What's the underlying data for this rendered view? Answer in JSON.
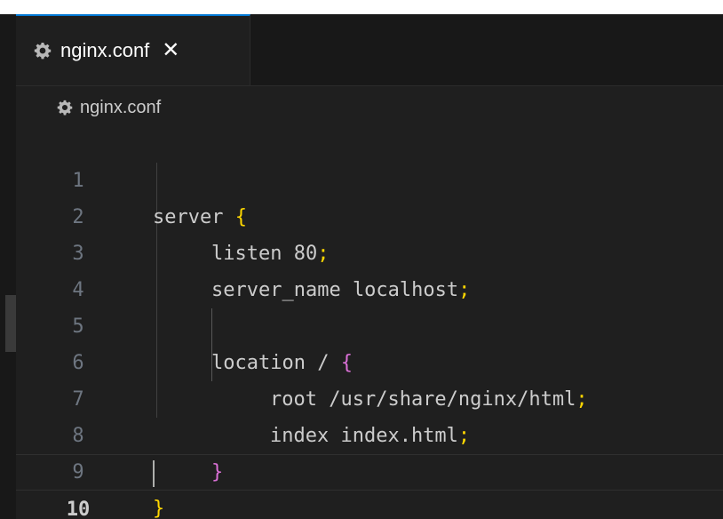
{
  "tab": {
    "label": "nginx.conf",
    "close_glyph": "✕",
    "icon": "gear-icon"
  },
  "breadcrumb": {
    "label": "nginx.conf",
    "icon": "gear-icon"
  },
  "colors": {
    "tab_accent": "#0078d4",
    "bracket_level1": "#ffd700",
    "bracket_level2": "#da70d6"
  },
  "code": {
    "lines": [
      {
        "number": "1",
        "parts": [
          "server ",
          "{"
        ]
      },
      {
        "number": "2",
        "parts": [
          "listen 80",
          ";"
        ]
      },
      {
        "number": "3",
        "parts": [
          "server_name localhost",
          ";"
        ]
      },
      {
        "number": "4",
        "parts": []
      },
      {
        "number": "5",
        "parts": [
          "location / ",
          "{"
        ]
      },
      {
        "number": "6",
        "parts": [
          "root /usr/share/nginx/html",
          ";"
        ]
      },
      {
        "number": "7",
        "parts": [
          "index index.html",
          ";"
        ]
      },
      {
        "number": "8",
        "parts": [
          "}"
        ]
      },
      {
        "number": "9",
        "parts": [
          "}"
        ]
      },
      {
        "number": "10",
        "parts": []
      }
    ],
    "current_line": "10"
  }
}
